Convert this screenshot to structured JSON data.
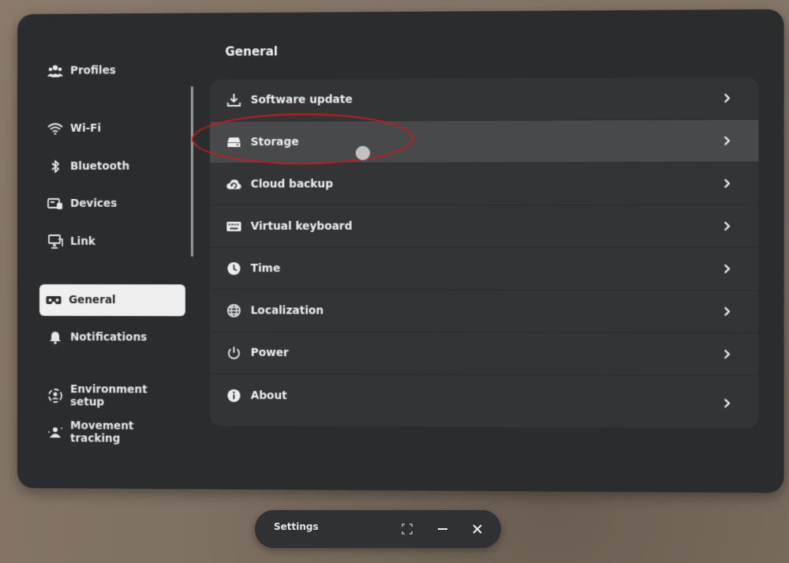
{
  "sidebar": {
    "items": [
      {
        "label": "Profiles",
        "icon": "people-icon"
      },
      {
        "label": "Wi-Fi",
        "icon": "wifi-icon"
      },
      {
        "label": "Bluetooth",
        "icon": "bluetooth-icon"
      },
      {
        "label": "Devices",
        "icon": "devices-icon"
      },
      {
        "label": "Link",
        "icon": "link-icon"
      },
      {
        "label": "General",
        "icon": "headset-icon",
        "active": true
      },
      {
        "label": "Notifications",
        "icon": "bell-icon"
      },
      {
        "label": "Environment setup",
        "icon": "environment-icon"
      },
      {
        "label": "Movement tracking",
        "icon": "movement-icon"
      }
    ]
  },
  "main": {
    "title": "General",
    "rows": [
      {
        "label": "Software update",
        "icon": "download-icon"
      },
      {
        "label": "Storage",
        "icon": "storage-icon",
        "highlighted": true
      },
      {
        "label": "Cloud backup",
        "icon": "cloud-backup-icon"
      },
      {
        "label": "Virtual keyboard",
        "icon": "keyboard-icon"
      },
      {
        "label": "Time",
        "icon": "clock-icon"
      },
      {
        "label": "Localization",
        "icon": "globe-icon"
      },
      {
        "label": "Power",
        "icon": "power-icon"
      },
      {
        "label": "About",
        "icon": "info-icon"
      }
    ]
  },
  "taskbar": {
    "title": "Settings",
    "buttons": [
      "expand-icon",
      "minimize-icon",
      "close-icon"
    ]
  },
  "colors": {
    "panel": "#2b2c2e",
    "list": "#333436",
    "highlight_row": "#48494b",
    "active_sidebar": "#efefef",
    "annotation": "#c41d1d"
  }
}
